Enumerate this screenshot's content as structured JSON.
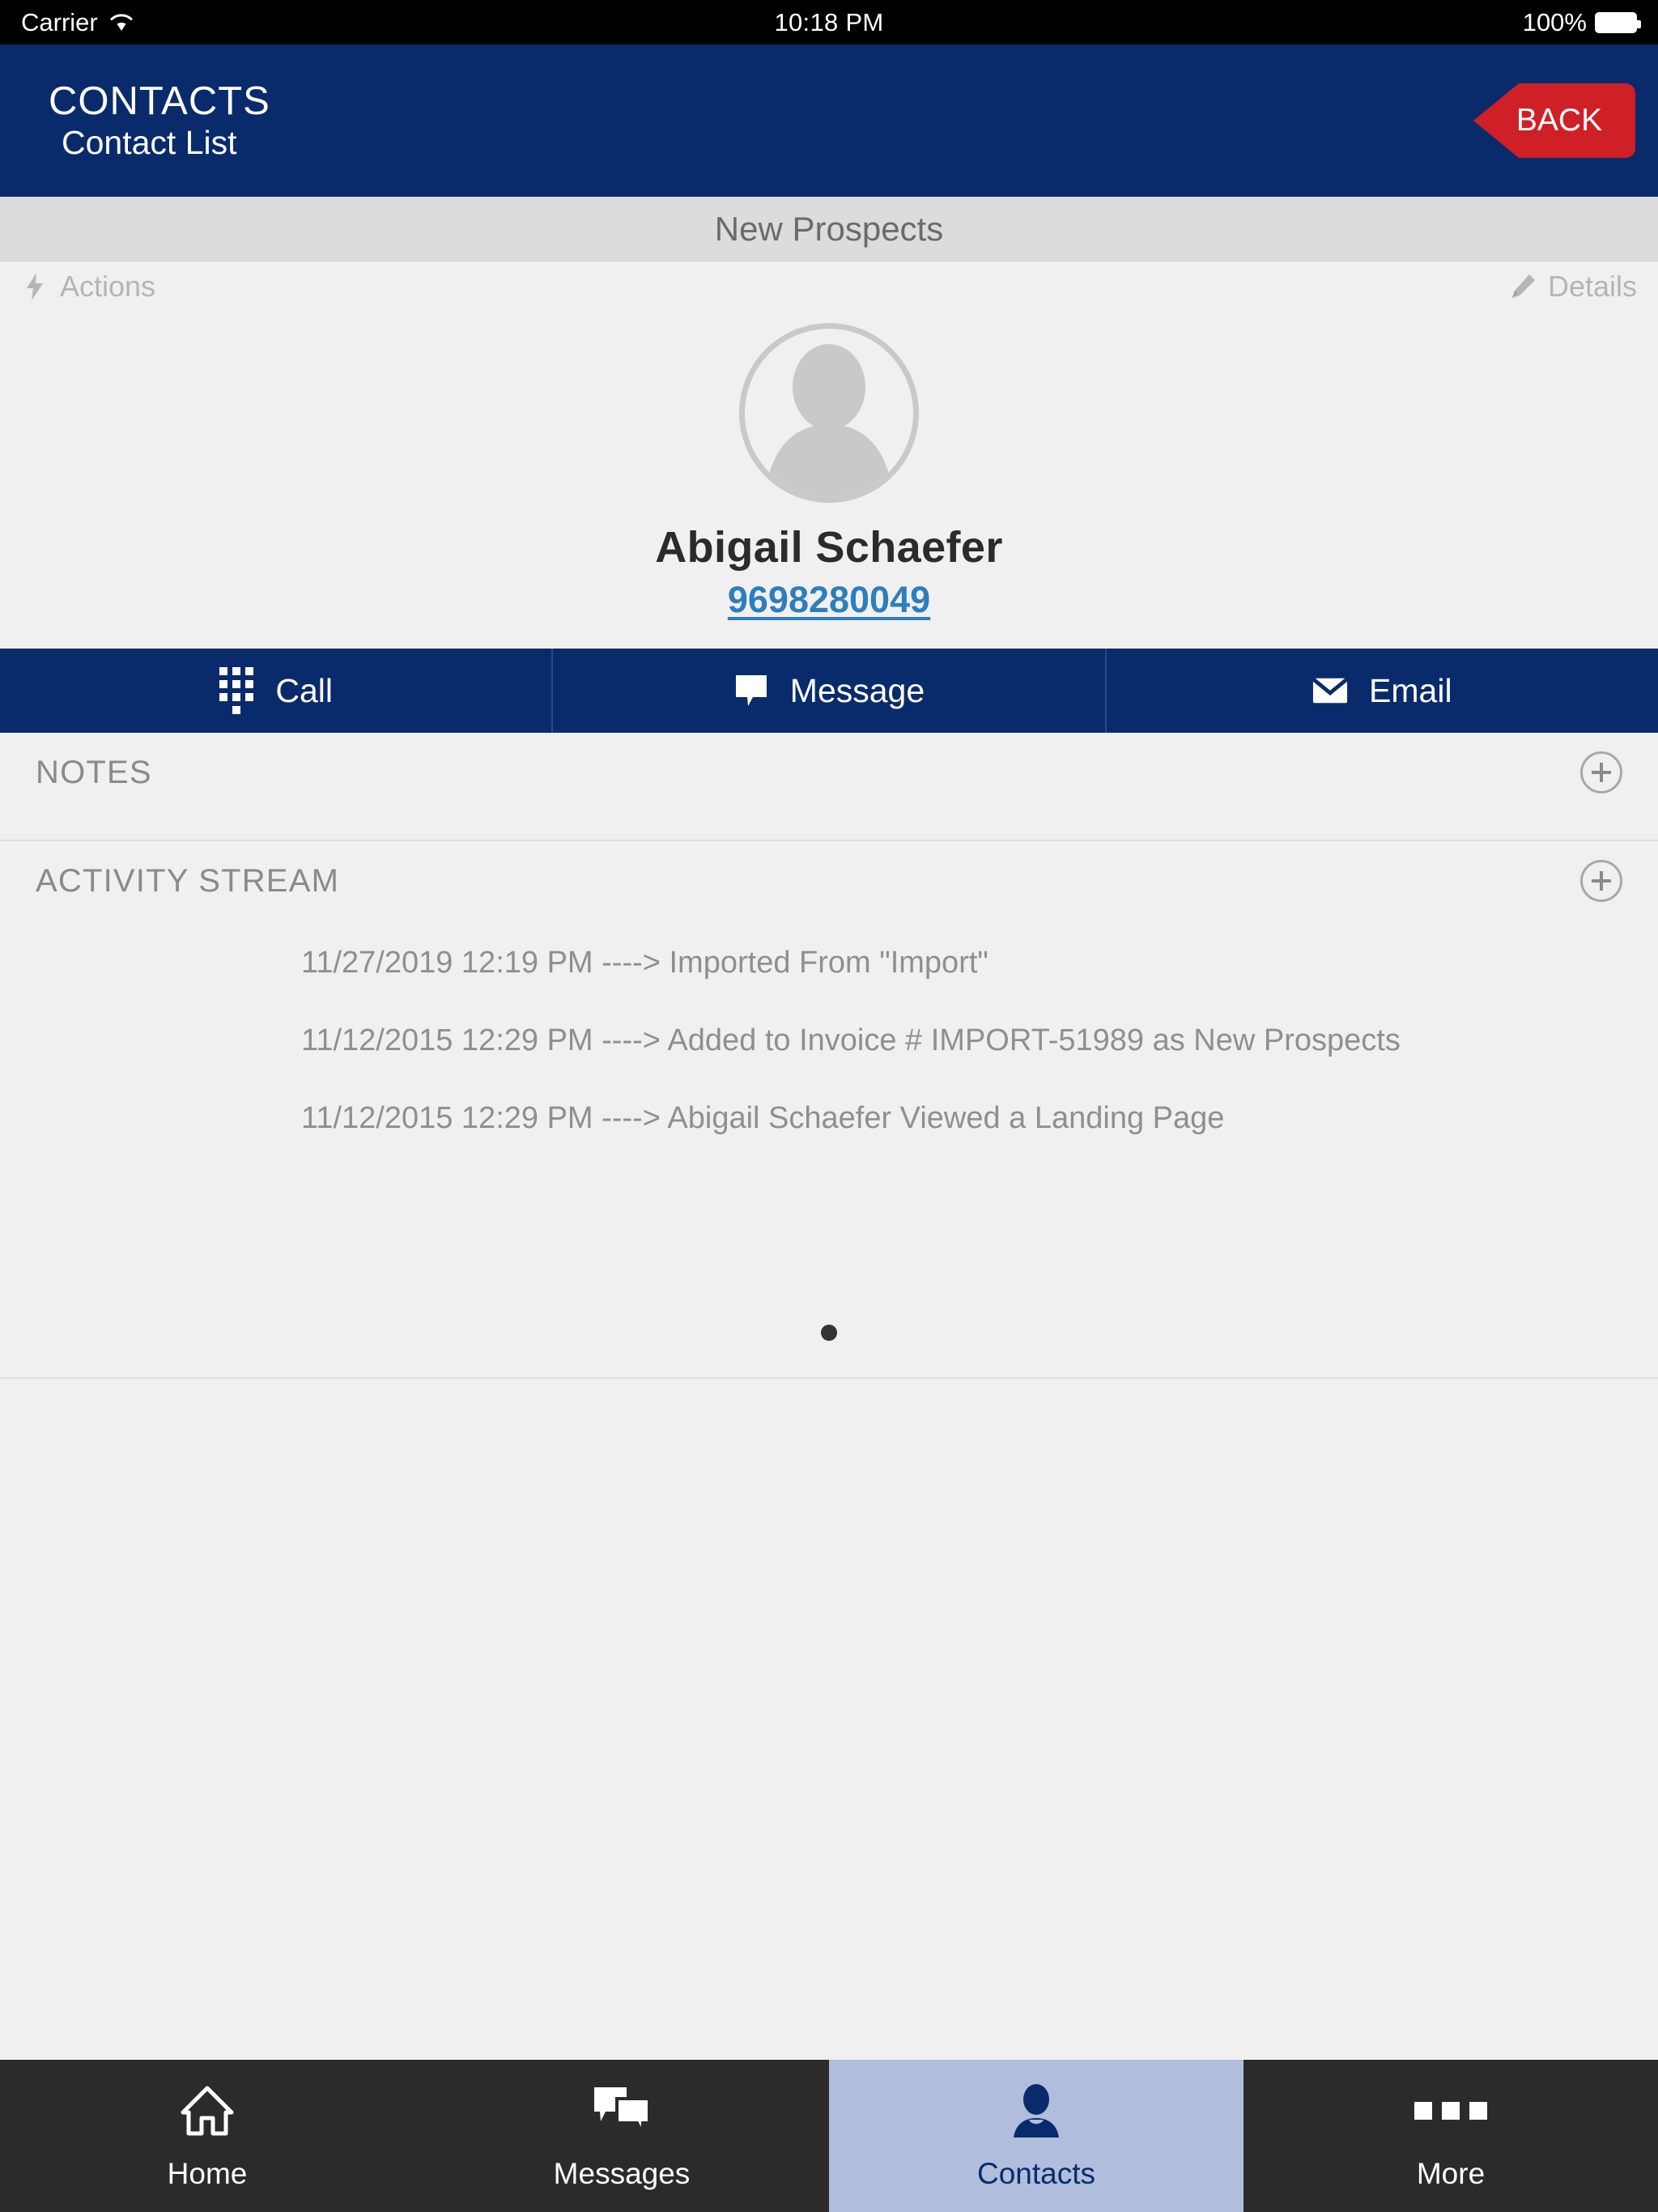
{
  "status_bar": {
    "carrier": "Carrier",
    "wifi_icon": "wifi-icon",
    "time": "10:18 PM",
    "battery_percent": "100%",
    "battery_icon": "battery-full-icon"
  },
  "header": {
    "title": "CONTACTS",
    "subtitle": "Contact List",
    "back_label": "BACK",
    "background_color": "#0a2b6b",
    "back_color": "#cf2027"
  },
  "group_bar": {
    "label": "New Prospects"
  },
  "tools": {
    "actions_label": "Actions",
    "actions_icon": "lightning-bolt-icon",
    "details_label": "Details",
    "details_icon": "pencil-icon"
  },
  "contact": {
    "avatar_icon": "person-placeholder-icon",
    "name": "Abigail Schaefer",
    "phone": "9698280049",
    "phone_color": "#2e7ebb"
  },
  "action_bar": {
    "items": [
      {
        "label": "Call",
        "icon": "dialpad-icon"
      },
      {
        "label": "Message",
        "icon": "speech-bubble-icon"
      },
      {
        "label": "Email",
        "icon": "envelope-icon"
      }
    ]
  },
  "notes": {
    "title": "NOTES",
    "add_icon": "plus-circle-icon"
  },
  "activity": {
    "title": "ACTIVITY STREAM",
    "add_icon": "plus-circle-icon",
    "entries": [
      "11/27/2019 12:19 PM ----> Imported From \"Import\"",
      "11/12/2015 12:29 PM ----> Added to Invoice # IMPORT-51989 as New Prospects",
      "11/12/2015 12:29 PM ----> Abigail Schaefer Viewed a Landing Page"
    ],
    "page_dots": 1
  },
  "tab_bar": {
    "active_index": 2,
    "active_background": "#b0bddc",
    "items": [
      {
        "label": "Home",
        "icon": "home-icon"
      },
      {
        "label": "Messages",
        "icon": "chat-bubbles-icon"
      },
      {
        "label": "Contacts",
        "icon": "person-icon"
      },
      {
        "label": "More",
        "icon": "ellipsis-icon"
      }
    ]
  }
}
